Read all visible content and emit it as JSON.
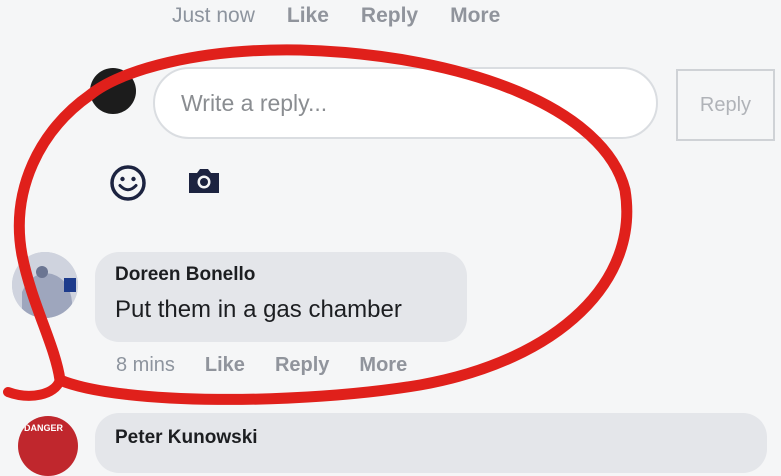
{
  "top_comment_actions": {
    "timestamp": "Just now",
    "like": "Like",
    "reply": "Reply",
    "more": "More"
  },
  "reply_box": {
    "placeholder": "Write a reply...",
    "button": "Reply"
  },
  "icons": [
    "emoji-icon",
    "camera-icon"
  ],
  "comment": {
    "author": "Doreen Bonello",
    "text": "Put them in a gas chamber",
    "timestamp": "8 mins",
    "like": "Like",
    "reply": "Reply",
    "more": "More"
  },
  "next_comment": {
    "author": "Peter Kunowski",
    "avatar_text": "DANGER"
  },
  "colors": {
    "annotation_red": "#e0201b",
    "bubble": "#e4e6ea",
    "background": "#f5f6f7"
  }
}
